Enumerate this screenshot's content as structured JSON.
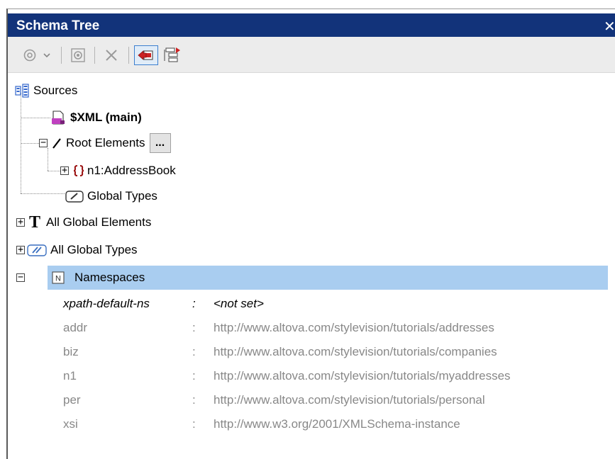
{
  "window": {
    "title": "Schema Tree",
    "close_glyph": "✕"
  },
  "toolbar": {
    "buttons": [
      {
        "name": "add-source-icon"
      },
      {
        "name": "dropdown-arrow-icon"
      },
      {
        "name": "settings-icon"
      },
      {
        "name": "delete-icon"
      },
      {
        "name": "pin-icon"
      },
      {
        "name": "collapse-icon"
      }
    ]
  },
  "tree": {
    "root_label": "Sources",
    "xml_main": "$XML (main)",
    "root_elements": "Root Elements",
    "root_elements_button": "...",
    "address_book": "n1:AddressBook",
    "global_types": "Global Types",
    "all_global_elements": "All Global Elements",
    "all_global_types": "All Global Types",
    "namespaces": "Namespaces"
  },
  "namespaces": {
    "rows": [
      {
        "prefix": "xpath-default-ns",
        "sep": ":",
        "uri": "<not set>"
      },
      {
        "prefix": "addr",
        "sep": ":",
        "uri": "http://www.altova.com/stylevision/tutorials/addresses"
      },
      {
        "prefix": "biz",
        "sep": ":",
        "uri": "http://www.altova.com/stylevision/tutorials/companies"
      },
      {
        "prefix": "n1",
        "sep": ":",
        "uri": "http://www.altova.com/stylevision/tutorials/myaddresses"
      },
      {
        "prefix": "per",
        "sep": ":",
        "uri": "http://www.altova.com/stylevision/tutorials/personal"
      },
      {
        "prefix": "xsi",
        "sep": ":",
        "uri": "http://www.w3.org/2001/XMLSchema-instance"
      }
    ]
  },
  "colors": {
    "titlebar": "#12337a",
    "selection": "#a9cdf0",
    "grey_text": "#888888"
  }
}
